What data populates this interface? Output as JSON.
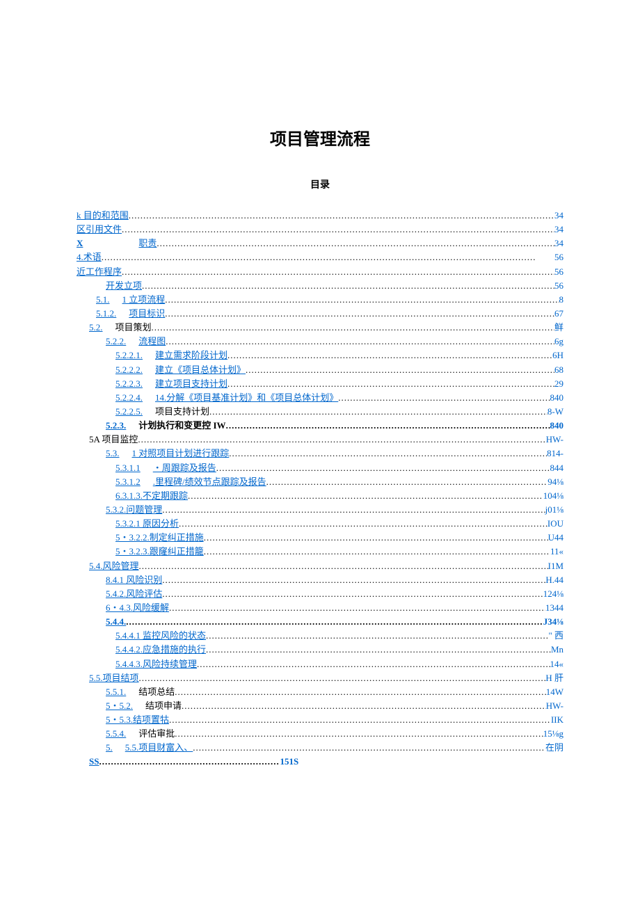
{
  "title": "项目管理流程",
  "subtitle": "目录",
  "entries": [
    {
      "indent": 0,
      "link": "k 目的和范围",
      "page": "34",
      "bold": false
    },
    {
      "indent": 0,
      "link": "区引用文件",
      "page": "34",
      "bold": false
    },
    {
      "indent": 0,
      "link": "X",
      "gap": true,
      "label2": "职责",
      "page": "34",
      "bold": false,
      "plainX": true
    },
    {
      "indent": 0,
      "link": "4.术语",
      "page": "56",
      "bold": false
    },
    {
      "indent": 0,
      "link": "近工作程序",
      "page": "56",
      "bold": false
    },
    {
      "indent": 2,
      "link": "开发立项",
      "page": "56",
      "bold": false
    },
    {
      "indent": 1,
      "link": "5.1.",
      "label2": "1   立项流程",
      "page": "8",
      "bold": false
    },
    {
      "indent": 1,
      "link": "5.1.2.",
      "label2": "项目标识",
      "page": "67",
      "bold": false
    },
    {
      "indent": 1,
      "link": "5.2.",
      "nolink": false,
      "spaced": true,
      "label2": "项目策划",
      "page": "鲜",
      "bold": false,
      "l2plain": true,
      "l1narrow": true
    },
    {
      "indent": 2,
      "link": "5.2.2.",
      "label2": "流程图",
      "page": "6g",
      "bold": false
    },
    {
      "indent": 3,
      "link": "5.2.2.1.",
      "label2": "建立需求阶段计划",
      "page": "6H",
      "bold": false
    },
    {
      "indent": 3,
      "link": "5.2.2.2.",
      "label2": "建立《项目总体计划》",
      "page": "68",
      "bold": false
    },
    {
      "indent": 3,
      "link": "5.2.2.3.",
      "label2": "建立项目支持计划",
      "page": "29",
      "bold": false
    },
    {
      "indent": 3,
      "link": "5.2.2.4.",
      "label2": "14.分解《项目基准计划》和《项目总体计划》",
      "page": "840",
      "bold": false
    },
    {
      "indent": 3,
      "link": "5.2.2.5.",
      "label2": "项目支持计划",
      "page": "8-W",
      "bold": false,
      "l2plain": true
    },
    {
      "indent": 2,
      "link": "5.2.3.",
      "label2": "计划执行和变更控 IW",
      "page": "840",
      "bold": true,
      "l2plain": true
    },
    {
      "indent": 1,
      "link": "5A 项目监控",
      "page": "HW-",
      "bold": false,
      "plainX": true,
      "l1narrow": true
    },
    {
      "indent": 2,
      "link": "5.3.",
      "label2": "1   对照项目计划进行跟踪",
      "page": "814-",
      "bold": false
    },
    {
      "indent": 3,
      "link": "5.3.1.1",
      "label2": "・周跟踪及报告",
      "page": "844",
      "bold": false
    },
    {
      "indent": 3,
      "link": "5.3.1.2",
      "label2": ".里程碑/绩效节点跟踪及报告",
      "page": "94⅛",
      "bold": false
    },
    {
      "indent": 3,
      "link": "6.3.1.3.不定期跟踪",
      "page": "104⅛",
      "bold": false
    },
    {
      "indent": 2,
      "link": "5.3.2.问题管理",
      "page": "j01⅛",
      "bold": false
    },
    {
      "indent": 3,
      "link": "5.3.2.1 原因分析",
      "page": "IOU",
      "bold": false
    },
    {
      "indent": 3,
      "link": "5・3.2.2.制定纠正措施",
      "page": "U44",
      "bold": false
    },
    {
      "indent": 3,
      "link": "5・3.2.3.跟窿纠正措籠",
      "page": "11«",
      "bold": false
    },
    {
      "indent": 1,
      "link": "5.4.风险管理",
      "page": "I1M",
      "bold": false,
      "l1narrow": true
    },
    {
      "indent": 2,
      "link": "8.4.1 风险识别",
      "page": "H.44",
      "bold": false
    },
    {
      "indent": 2,
      "link": "5.4.2.风险评估",
      "page": "124⅛",
      "bold": false
    },
    {
      "indent": 2,
      "link": "6・4.3.风险缓解",
      "page": "1344",
      "bold": false
    },
    {
      "indent": 2,
      "link": "5.4.4.",
      "page": "J34⅛",
      "bold": true
    },
    {
      "indent": 3,
      "link": "5.4.4.1 监控风险的状态",
      "page": "\" 西",
      "bold": false
    },
    {
      "indent": 3,
      "link": "5.4.4.2.应急措施的执行",
      "page": "Mn",
      "bold": false
    },
    {
      "indent": 3,
      "link": "5.4.4.3.风险持续管理",
      "page": "14«",
      "bold": false
    },
    {
      "indent": 1,
      "link": "5.5.项目结项",
      "page": "H 肝",
      "bold": false,
      "l1narrow": true
    },
    {
      "indent": 2,
      "link": "5.5.1.",
      "label2": "结项总结",
      "page": "14W",
      "bold": false,
      "l2plain": true
    },
    {
      "indent": 2,
      "link": "5・5.2.",
      "label2": "结项申请",
      "page": "HW-",
      "bold": false,
      "l2plain": true
    },
    {
      "indent": 2,
      "link": "5・5.3.结项置牯",
      "page": "IIK",
      "bold": false
    },
    {
      "indent": 2,
      "link": "5.5.4.",
      "label2": "评估审批",
      "page": "15⅛g",
      "bold": false,
      "l2plain": true
    },
    {
      "indent": 2,
      "link": "5.",
      "label2": "5.5.项目财富入、",
      "page": "在阴",
      "bold": false
    },
    {
      "indent": 1,
      "link": "SS",
      "page": "151S",
      "bold": true,
      "l1narrow": true,
      "shortdots": true
    }
  ]
}
